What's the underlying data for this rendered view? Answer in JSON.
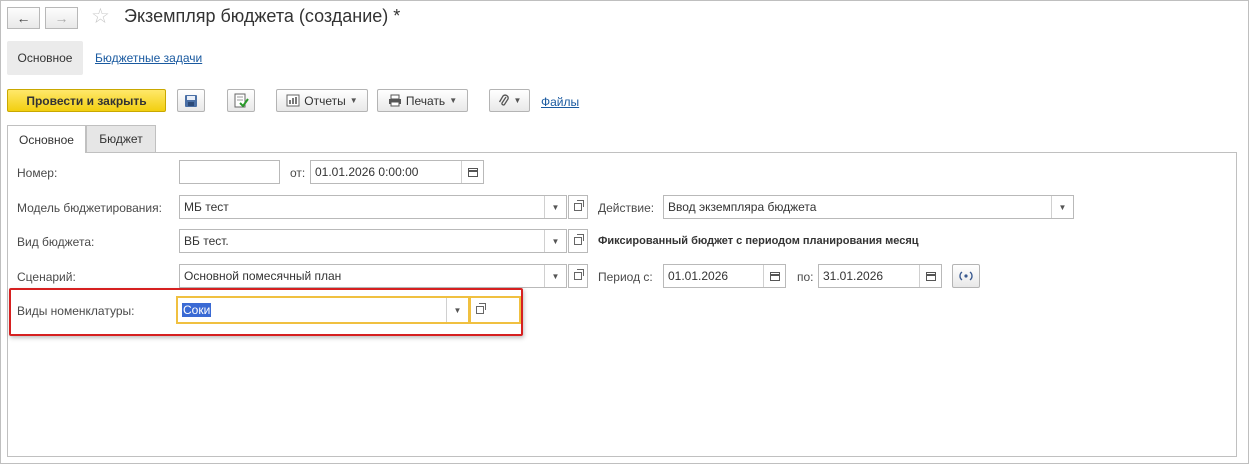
{
  "window": {
    "title": "Экземпляр бюджета (создание) *"
  },
  "section_tabs": {
    "main": "Основное",
    "budget_tasks": "Бюджетные задачи"
  },
  "toolbar": {
    "post_close": "Провести и закрыть",
    "reports": "Отчеты",
    "print": "Печать",
    "files": "Файлы"
  },
  "tabs": {
    "main": "Основное",
    "budget": "Бюджет"
  },
  "form": {
    "number_label": "Номер:",
    "number_value": "",
    "from_label": "от:",
    "date_value": "01.01.2026  0:00:00",
    "model_label": "Модель бюджетирования:",
    "model_value": "МБ тест",
    "action_label": "Действие:",
    "action_value": "Ввод экземпляра бюджета",
    "type_label": "Вид бюджета:",
    "type_value": "ВБ тест.",
    "fixed_note": "Фиксированный бюджет с периодом планирования месяц",
    "scenario_label": "Сценарий:",
    "scenario_value": "Основной помесячный план",
    "period_from_label": "Период с:",
    "period_from_value": "01.01.2026",
    "period_to_label": "по:",
    "period_to_value": "31.01.2026",
    "nomenclature_label": "Виды номенклатуры:",
    "nomenclature_value": "Соки"
  },
  "colors": {
    "primary_button": "#f2cf10",
    "highlight_box": "#d62020",
    "focus_border": "#f0c040",
    "link": "#1a5aa0"
  }
}
